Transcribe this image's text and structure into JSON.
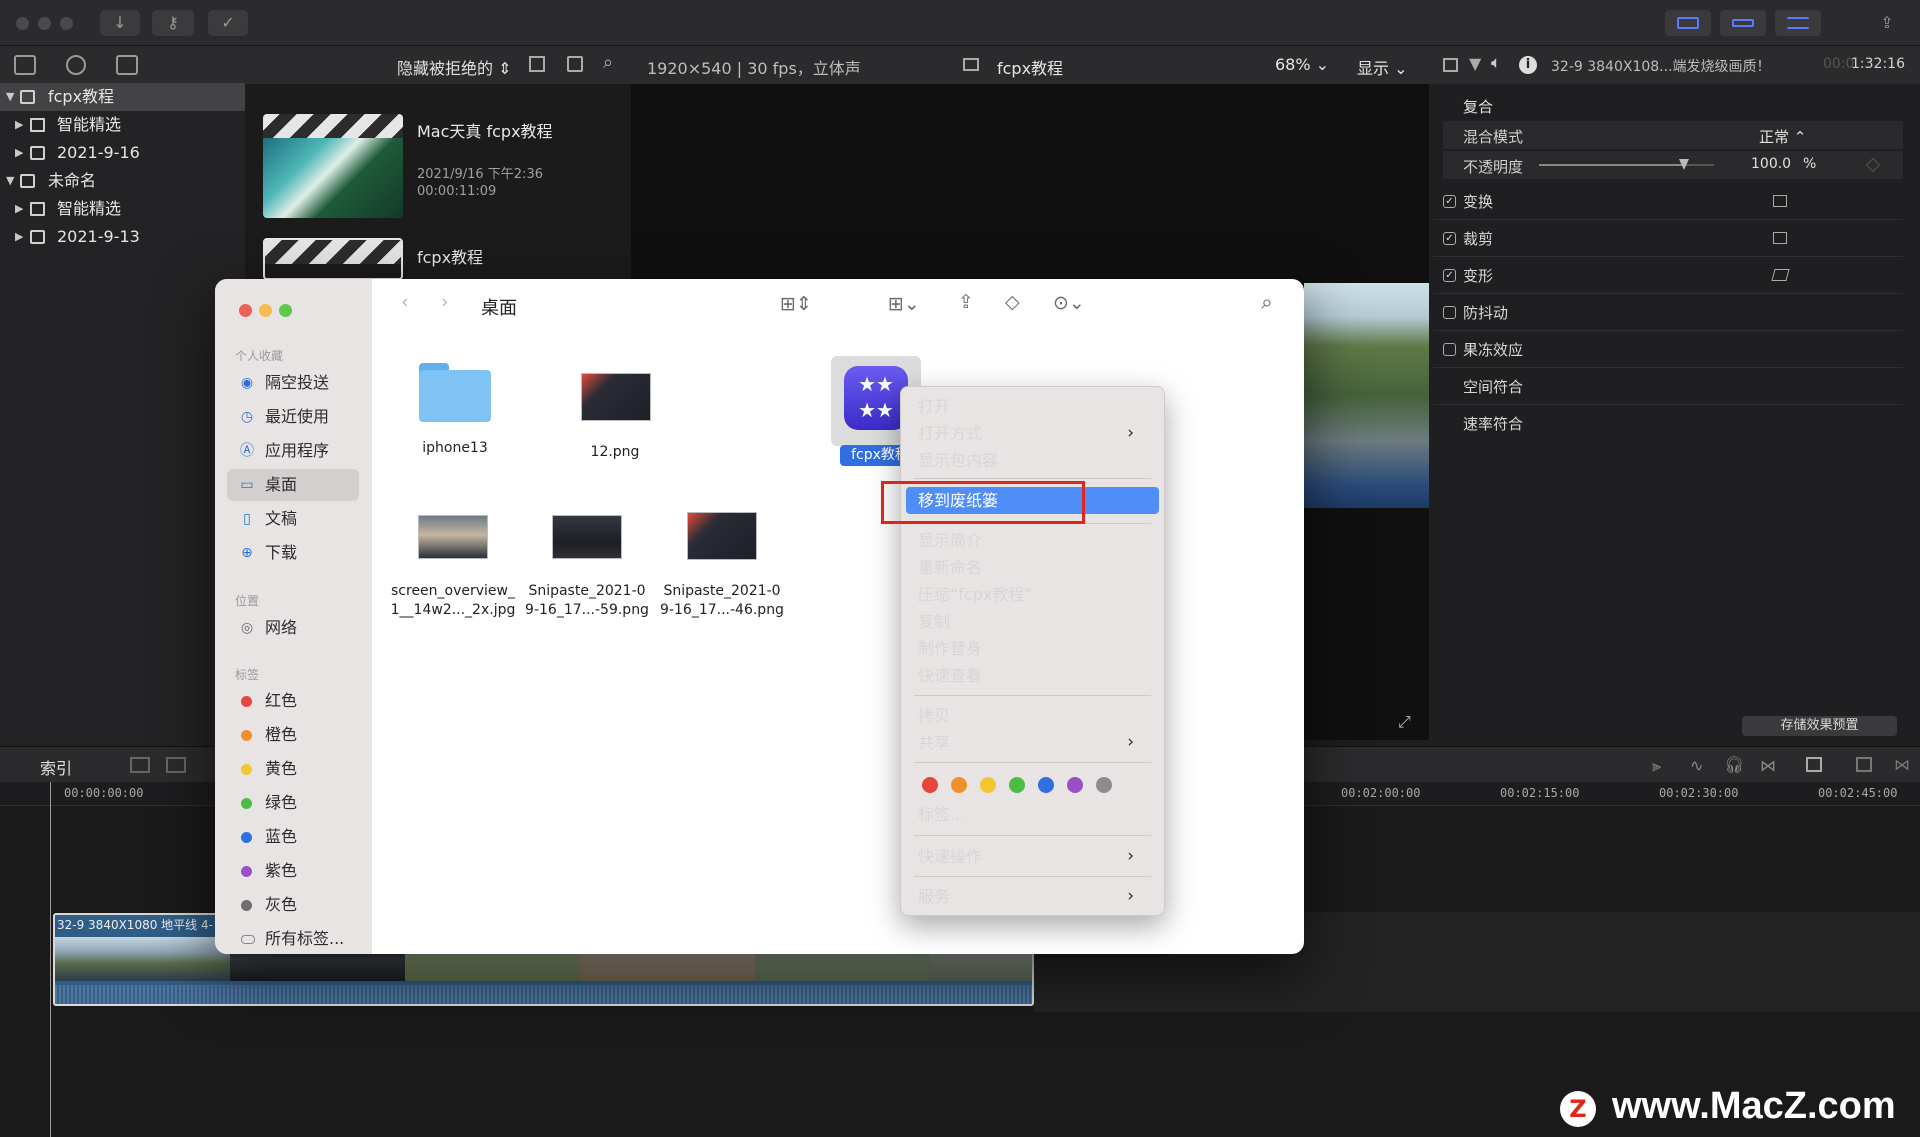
{
  "library": {
    "items": [
      {
        "label": "fcpx教程",
        "expanded": true
      },
      {
        "label": "智能精选"
      },
      {
        "label": "2021-9-16"
      },
      {
        "label": "未命名",
        "expanded": true
      },
      {
        "label": "智能精选"
      },
      {
        "label": "2021-9-13"
      }
    ]
  },
  "browser": {
    "filter_label": "隐藏被拒绝的",
    "clips": [
      {
        "title": "Mac天真 fcpx教程",
        "date": "2021/9/16 下午2:36",
        "duration": "00:00:11:09"
      },
      {
        "title": "fcpx教程"
      }
    ]
  },
  "viewer": {
    "format": "1920×540 | 30 fps，立体声",
    "project": "fcpx教程",
    "zoom": "68%",
    "display": "显示"
  },
  "inspector": {
    "clip_name": "32-9 3840X108...端发烧级画质！",
    "timecode_dim": "00:0",
    "timecode": "1:32:16",
    "section": "复合",
    "blend_label": "混合模式",
    "blend_value": "正常 ⌃",
    "opacity_label": "不透明度",
    "opacity_value": "100.0",
    "opacity_unit": "%",
    "opacity_level": 1.0,
    "rows": [
      {
        "label": "变换",
        "checked": true
      },
      {
        "label": "裁剪",
        "checked": true
      },
      {
        "label": "变形",
        "checked": true
      },
      {
        "label": "防抖动",
        "checked": false
      },
      {
        "label": "果冻效应",
        "checked": false
      },
      {
        "label": "空间符合"
      },
      {
        "label": "速率符合"
      }
    ],
    "save_preset": "存储效果预置"
  },
  "timeline": {
    "index_tab": "索引",
    "ruler": [
      "00:00:00:00",
      "00:02:00:00",
      "00:02:15:00",
      "00:02:30:00",
      "00:02:45:00"
    ],
    "clip_label": "32-9 3840X1080 地平线 4-"
  },
  "finder": {
    "title": "桌面",
    "sidebar": {
      "favorites_header": "个人收藏",
      "favorites": [
        {
          "label": "隔空投送",
          "icon": "airdrop-icon"
        },
        {
          "label": "最近使用",
          "icon": "clock-icon"
        },
        {
          "label": "应用程序",
          "icon": "apps-icon"
        },
        {
          "label": "桌面",
          "icon": "desktop-icon",
          "selected": true
        },
        {
          "label": "文稿",
          "icon": "document-icon"
        },
        {
          "label": "下载",
          "icon": "download-icon"
        }
      ],
      "locations_header": "位置",
      "locations": [
        {
          "label": "网络",
          "icon": "globe-icon"
        }
      ],
      "tags_header": "标签",
      "tags": [
        {
          "label": "红色",
          "color": "#e8453c"
        },
        {
          "label": "橙色",
          "color": "#f0902d"
        },
        {
          "label": "黄色",
          "color": "#f3c530"
        },
        {
          "label": "绿色",
          "color": "#4cbc45"
        },
        {
          "label": "蓝色",
          "color": "#2f6fe0"
        },
        {
          "label": "紫色",
          "color": "#9a4fc9"
        },
        {
          "label": "灰色",
          "color": "#8c8c8c"
        },
        {
          "label": "所有标签..."
        }
      ]
    },
    "files": [
      {
        "name": "iphone13",
        "kind": "folder"
      },
      {
        "name": "12.png",
        "kind": "image"
      },
      {
        "name": "fcpx教程",
        "kind": "app",
        "selected": true
      },
      {
        "name_line1": "screen_overview_",
        "name_line2": "1__14w2..._2x.jpg",
        "kind": "image"
      },
      {
        "name_line1": "Snipaste_2021-0",
        "name_line2": "9-16_17...-59.png",
        "kind": "image"
      },
      {
        "name_line1": "Snipaste_2021-0",
        "name_line2": "9-16_17...-46.png",
        "kind": "image"
      }
    ]
  },
  "context_menu": {
    "items": [
      {
        "label": "打开"
      },
      {
        "label": "打开方式",
        "submenu": true
      },
      {
        "label": "显示包内容"
      },
      {
        "label": "移到废纸篓",
        "highlighted": true
      },
      {
        "label": "显示简介"
      },
      {
        "label": "重新命名"
      },
      {
        "label": "压缩“fcpx教程”"
      },
      {
        "label": "复制"
      },
      {
        "label": "制作替身"
      },
      {
        "label": "快速查看"
      },
      {
        "label": "拷贝"
      },
      {
        "label": "共享",
        "submenu": true
      },
      {
        "label": "标签..."
      },
      {
        "label": "快速操作",
        "submenu": true
      },
      {
        "label": "服务",
        "submenu": true
      }
    ],
    "tag_colors": [
      "#e8453c",
      "#f0902d",
      "#f3c530",
      "#4cbc45",
      "#2f6fe0",
      "#9a4fc9",
      "#8c8c8c"
    ]
  },
  "watermark": {
    "text": "www.MacZ.com",
    "logo": "Z"
  }
}
